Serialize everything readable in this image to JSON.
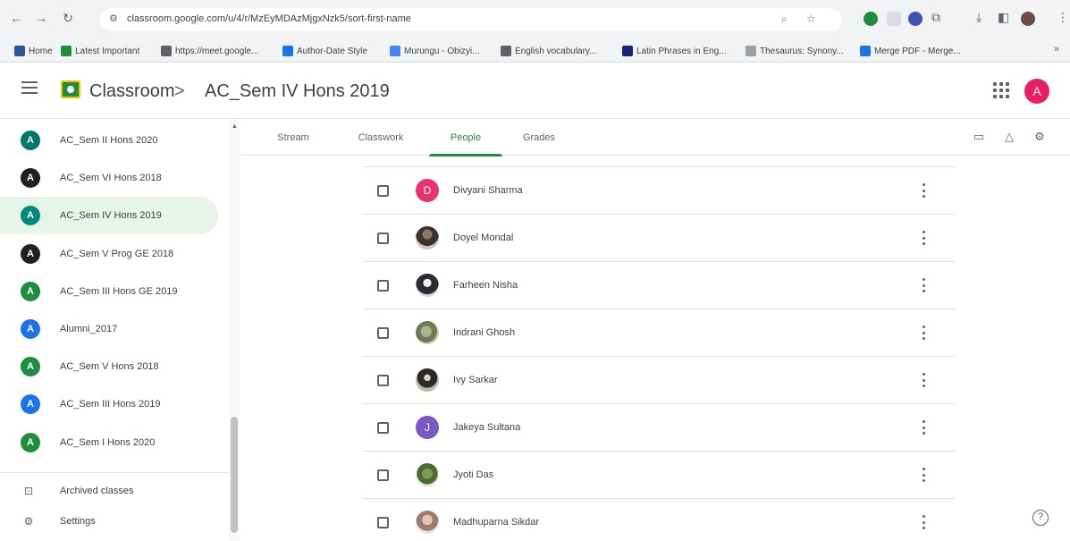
{
  "browser": {
    "url": "classroom.google.com/u/4/r/MzEyMDAzMjgxNzk5/sort-first-name",
    "back_icon": "←",
    "forward_icon": "→",
    "reload_icon": "↻",
    "site_icon": "⚙",
    "bookmarks": [
      {
        "label": "Home",
        "color": "#2b579a"
      },
      {
        "label": "Latest Important",
        "color": "#1e8e3e"
      },
      {
        "label": "https://meet.google...",
        "color": "#5f6368"
      },
      {
        "label": "Author-Date Style",
        "color": "#1a73e8"
      },
      {
        "label": "Murungu - Obizyi...",
        "color": "#4285f4"
      },
      {
        "label": "English vocabulary...",
        "color": "#5f6368"
      },
      {
        "label": "Latin Phrases in Eng...",
        "color": "#1a237e"
      },
      {
        "label": "Thesaurus: Synony...",
        "color": "#9aa0a6"
      },
      {
        "label": "Merge PDF - Merge...",
        "color": "#1a73e8"
      }
    ],
    "bookmarks_more": "»"
  },
  "header": {
    "app_name": "Classroom",
    "separator": ">",
    "class_name": "AC_Sem IV Hons 2019",
    "account_initial": "A",
    "account_color": "#e91e63"
  },
  "sidebar": {
    "classes": [
      {
        "initial": "A",
        "label": "AC_Sem II Hons 2020",
        "color": "#00796b",
        "active": false
      },
      {
        "initial": "A",
        "label": "AC_Sem VI Hons 2018",
        "color": "#202124",
        "active": false
      },
      {
        "initial": "A",
        "label": "AC_Sem IV Hons 2019",
        "color": "#00897b",
        "active": true
      },
      {
        "initial": "A",
        "label": "AC_Sem V Prog GE 2018",
        "color": "#202124",
        "active": false
      },
      {
        "initial": "A",
        "label": "AC_Sem III Hons GE 2019",
        "color": "#1e8e3e",
        "active": false
      },
      {
        "initial": "A",
        "label": "Alumni_2017",
        "color": "#1a73e8",
        "active": false
      },
      {
        "initial": "A",
        "label": "AC_Sem V Hons 2018",
        "color": "#1e8e3e",
        "active": false
      },
      {
        "initial": "A",
        "label": "AC_Sem III Hons 2019",
        "color": "#1a73e8",
        "active": false
      },
      {
        "initial": "A",
        "label": "AC_Sem I Hons 2020",
        "color": "#1e8e3e",
        "active": false
      }
    ],
    "archived_label": "Archived classes",
    "settings_label": "Settings"
  },
  "tabs": [
    {
      "label": "Stream",
      "active": false
    },
    {
      "label": "Classwork",
      "active": false
    },
    {
      "label": "People",
      "active": true
    },
    {
      "label": "Grades",
      "active": false
    }
  ],
  "people": [
    {
      "name": "Divyani Sharma",
      "avatar": "initial",
      "initial": "D",
      "color": "#e8336e"
    },
    {
      "name": "Doyel Mondal",
      "avatar": "photo",
      "photo": "p1"
    },
    {
      "name": "Farheen Nisha",
      "avatar": "photo",
      "photo": "p2"
    },
    {
      "name": "Indrani Ghosh",
      "avatar": "photo",
      "photo": "p3"
    },
    {
      "name": "Ivy Sarkar",
      "avatar": "photo",
      "photo": "p4"
    },
    {
      "name": "Jakeya Sultana",
      "avatar": "initial",
      "initial": "J",
      "color": "#7e57c2"
    },
    {
      "name": "Jyoti Das",
      "avatar": "photo",
      "photo": "p5"
    },
    {
      "name": "Madhuparna Sikdar",
      "avatar": "photo",
      "photo": "p6"
    }
  ],
  "help_label": "?"
}
